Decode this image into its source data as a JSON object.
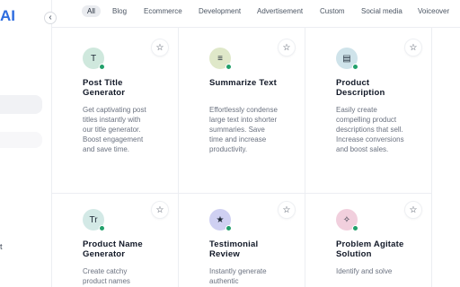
{
  "sidebar": {
    "logo_fragment": "AI",
    "item_fragment": "t"
  },
  "filters": [
    "All",
    "Blog",
    "Ecommerce",
    "Development",
    "Advertisement",
    "Custom",
    "Social media",
    "Voiceover"
  ],
  "active_filter": "All",
  "cards": [
    {
      "title": "Post Title Generator",
      "description": "Get captivating post titles instantly with our title generator. Boost engagement and save time.",
      "icon": "T",
      "icon_name": "text-t-icon",
      "icon_bg": "#cfe8dd"
    },
    {
      "title": "Summarize Text",
      "description": "Effortlessly condense large text into shorter summaries. Save time and increase productivity.",
      "icon": "≡",
      "icon_name": "lines-icon",
      "icon_bg": "#dfe8c9"
    },
    {
      "title": "Product Description",
      "description": "Easily create compelling product descriptions that sell. Increase conversions and boost sales.",
      "icon": "▤",
      "icon_name": "document-icon",
      "icon_bg": "#cfe3ea"
    },
    {
      "title": "Product Name Generator",
      "description": "Create catchy product names",
      "icon": "Tr",
      "icon_name": "text-tr-icon",
      "icon_bg": "#d3e9e6"
    },
    {
      "title": "Testimonial Review",
      "description": "Instantly generate authentic",
      "icon": "★",
      "icon_name": "star-filled-icon",
      "icon_bg": "#cfd0f2"
    },
    {
      "title": "Problem Agitate Solution",
      "description": "Identify and solve",
      "icon": "✧",
      "icon_name": "sparkle-icon",
      "icon_bg": "#f1cfdd"
    }
  ],
  "favorite_icon": "☆",
  "collapse_icon": "‹",
  "colors": {
    "accent": "#2d6cdf",
    "status_dot": "#22a06b"
  }
}
